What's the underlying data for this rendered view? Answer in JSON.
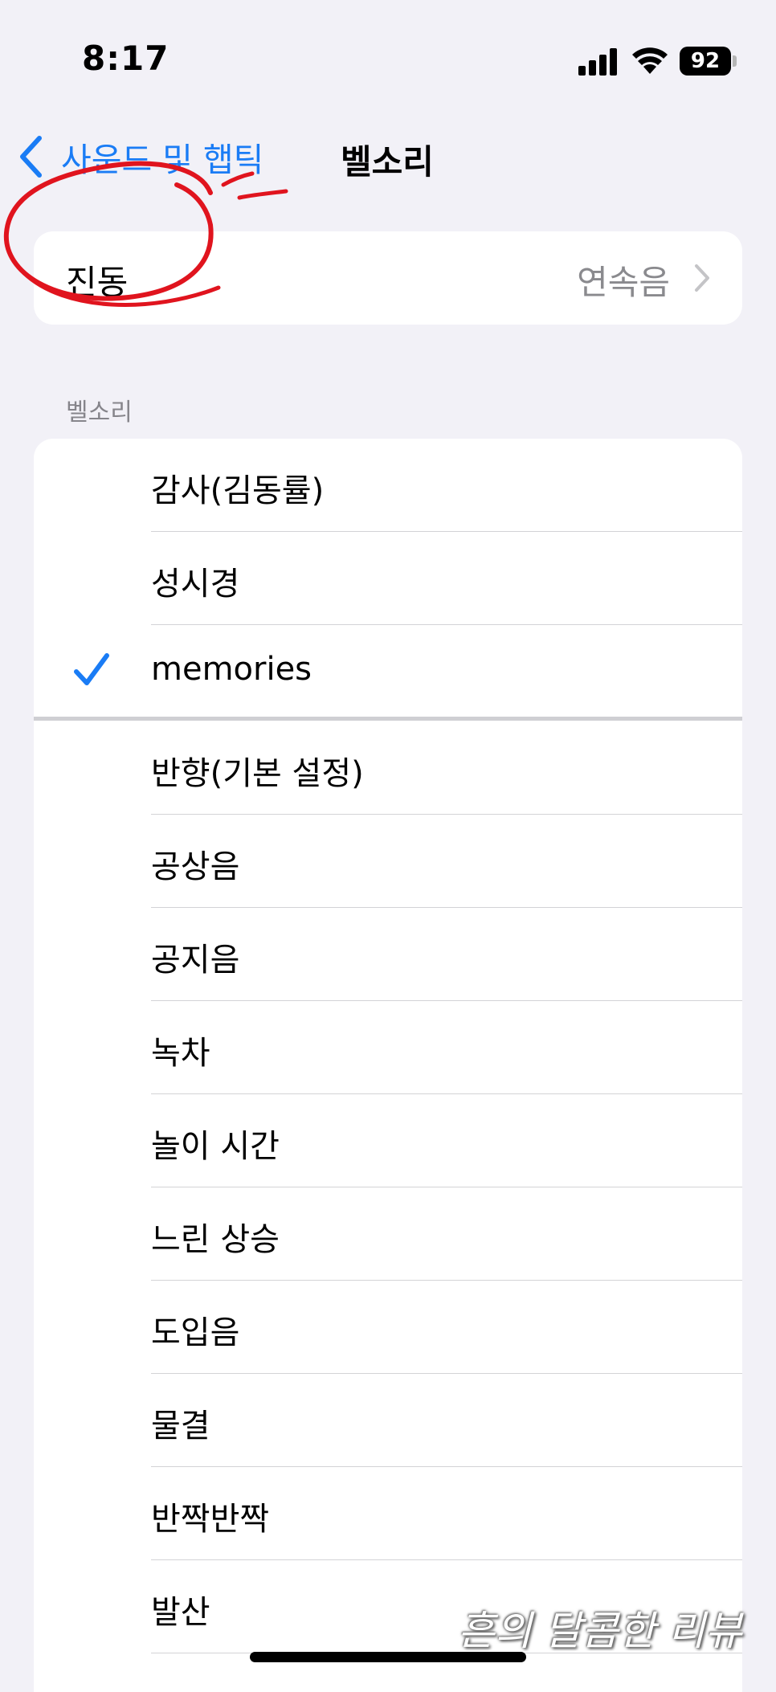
{
  "status_bar": {
    "time": "8:17",
    "battery": "92"
  },
  "nav": {
    "back_label": "사운드 및 햅틱",
    "title": "벨소리",
    "accent_color": "#1a7cf5"
  },
  "vibration": {
    "label": "진동",
    "value": "연속음"
  },
  "ringtones": {
    "section_header": "벨소리",
    "items": [
      {
        "label": "감사(김동률)",
        "selected": false
      },
      {
        "label": "성시경",
        "selected": false
      },
      {
        "label": "memories",
        "selected": true
      },
      {
        "label": "반향(기본 설정)",
        "selected": false
      },
      {
        "label": "공상음",
        "selected": false
      },
      {
        "label": "공지음",
        "selected": false
      },
      {
        "label": "녹차",
        "selected": false
      },
      {
        "label": "놀이 시간",
        "selected": false
      },
      {
        "label": "느린 상승",
        "selected": false
      },
      {
        "label": "도입음",
        "selected": false
      },
      {
        "label": "물결",
        "selected": false
      },
      {
        "label": "반짝반짝",
        "selected": false
      },
      {
        "label": "발산",
        "selected": false
      }
    ]
  },
  "watermark": "흔의 달콤한 리뷰",
  "annotation_color": "#e0141e"
}
